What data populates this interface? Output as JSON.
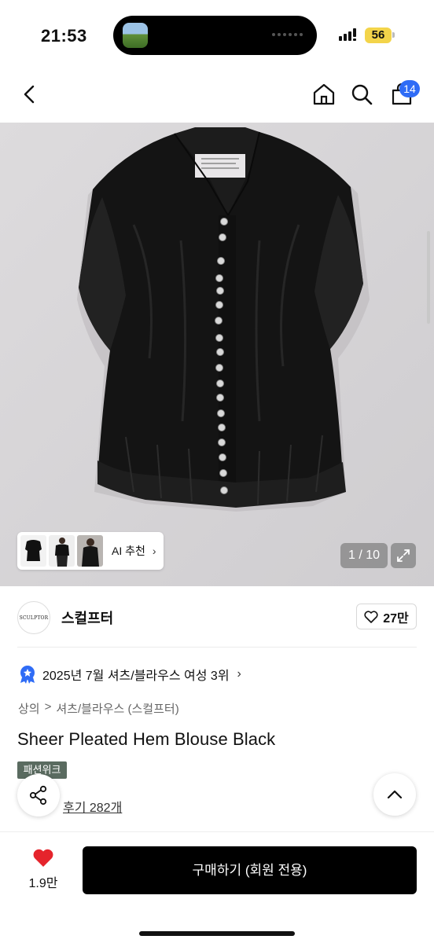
{
  "status_bar": {
    "time": "21:53",
    "battery": "56"
  },
  "header": {
    "cart_badge": "14",
    "icons": [
      "back-icon",
      "home-icon",
      "search-icon",
      "cart-icon"
    ]
  },
  "gallery": {
    "ai_recommend_label": "AI 추천",
    "counter": "1 / 10"
  },
  "brand": {
    "logo_text": "SCULPTOR",
    "name": "스컬프터",
    "likes": "27만"
  },
  "ranking": {
    "text": "2025년 7월 셔츠/블라우스 여성 3위"
  },
  "breadcrumb": [
    "상의",
    ">",
    "셔츠/블라우스 (스컬프터)"
  ],
  "product": {
    "title": "Sheer Pleated Hem Blouse Black",
    "event_tag": "패션위크",
    "review_label": "후기 282개"
  },
  "bottom_bar": {
    "wish_count": "1.9만",
    "buy_label": "구매하기 (회원 전용)"
  },
  "colors": {
    "accent_blue": "#2f6cf6",
    "heart_red": "#e5242c",
    "buy_button": "#000000",
    "battery": "#f3d44a"
  }
}
